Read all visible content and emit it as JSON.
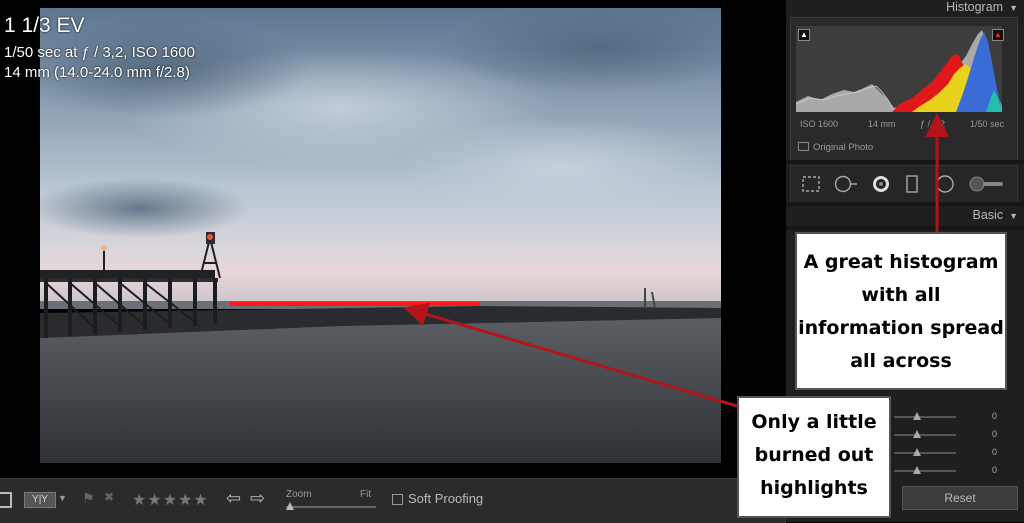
{
  "photo": {
    "ev": "1 1/3 EV",
    "exposure": "1/50 sec at ƒ / 3,2, ISO 1600",
    "lens": "14 mm (14.0-24.0 mm f/2.8)"
  },
  "panel": {
    "histogram_title": "Histogram",
    "histogram_meta": [
      "ISO 1600",
      "14 mm",
      "ƒ / 3,2",
      "1/50 sec"
    ],
    "original_photo_label": "Original Photo",
    "basic_title": "Basic",
    "slider_values": [
      "0",
      "0",
      "0",
      "0"
    ],
    "reset_label": "Reset",
    "tools": [
      "crop-overlay-icon",
      "spot-removal-icon",
      "red-eye-icon",
      "graduated-filter-icon",
      "radial-filter-icon",
      "adjustment-brush-icon"
    ]
  },
  "toolbar": {
    "view_yy": "Y|Y",
    "stars": "★★★★★",
    "zoom_label": "Zoom",
    "fit_label": "Fit",
    "soft_proofing_label": "Soft Proofing"
  },
  "annotations": {
    "histogram_callout": "A great histogram with all information spread all across",
    "burned_callout": "Only a little burned out highlights",
    "arrow_color": "#b3141a"
  },
  "colors": {
    "panel_bg": "#1f1f1f",
    "toolbar_bg": "#2b2b2b",
    "clipping_red": "#ff1a1a"
  }
}
